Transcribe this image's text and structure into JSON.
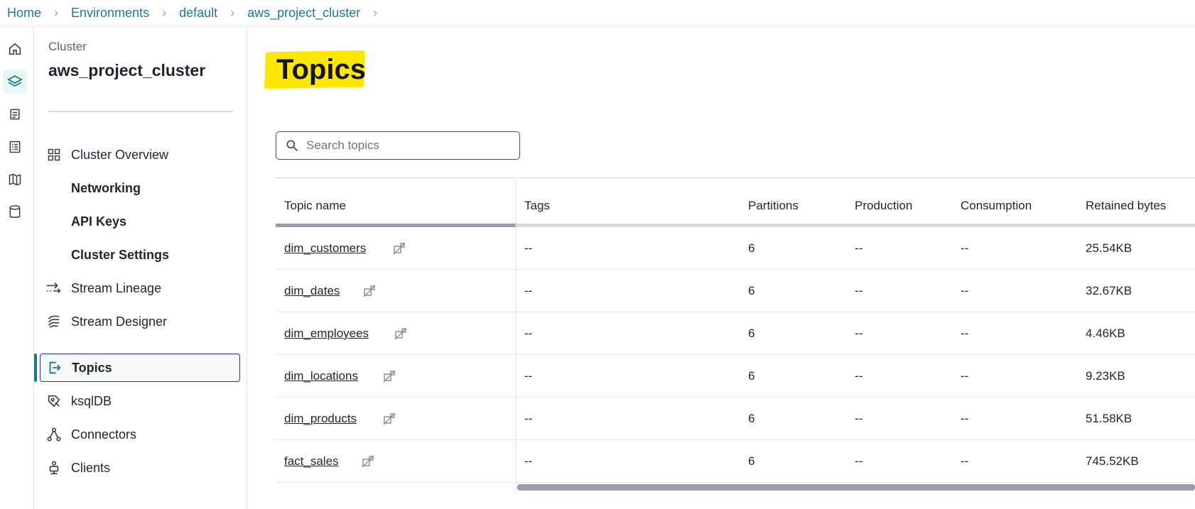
{
  "breadcrumb": {
    "items": [
      "Home",
      "Environments",
      "default",
      "aws_project_cluster"
    ]
  },
  "rail": {
    "icons": [
      "home-icon",
      "layers-icon",
      "document-icon",
      "checklist-icon",
      "map-icon",
      "database-icon"
    ]
  },
  "sidebar": {
    "caption": "Cluster",
    "title": "aws_project_cluster",
    "items": [
      {
        "label": "Cluster Overview",
        "icon": "grid-icon"
      },
      {
        "label": "Networking",
        "icon": ""
      },
      {
        "label": "API Keys",
        "icon": ""
      },
      {
        "label": "Cluster Settings",
        "icon": ""
      },
      {
        "label": "Stream Lineage",
        "icon": "lineage-icon"
      },
      {
        "label": "Stream Designer",
        "icon": "designer-icon"
      },
      {
        "label": "Topics",
        "icon": "topics-icon"
      },
      {
        "label": "ksqlDB",
        "icon": "ksqldb-icon"
      },
      {
        "label": "Connectors",
        "icon": "connectors-icon"
      },
      {
        "label": "Clients",
        "icon": "clients-icon"
      }
    ],
    "active": "Topics"
  },
  "main": {
    "title": "Topics",
    "search": {
      "placeholder": "Search topics",
      "value": ""
    }
  },
  "table": {
    "columns": [
      "Topic name",
      "Tags",
      "Partitions",
      "Production",
      "Consumption",
      "Retained bytes"
    ],
    "rows": [
      {
        "name": "dim_customers",
        "tags": "--",
        "partitions": "6",
        "production": "--",
        "consumption": "--",
        "retained": "25.54KB"
      },
      {
        "name": "dim_dates",
        "tags": "--",
        "partitions": "6",
        "production": "--",
        "consumption": "--",
        "retained": "32.67KB"
      },
      {
        "name": "dim_employees",
        "tags": "--",
        "partitions": "6",
        "production": "--",
        "consumption": "--",
        "retained": "4.46KB"
      },
      {
        "name": "dim_locations",
        "tags": "--",
        "partitions": "6",
        "production": "--",
        "consumption": "--",
        "retained": "9.23KB"
      },
      {
        "name": "dim_products",
        "tags": "--",
        "partitions": "6",
        "production": "--",
        "consumption": "--",
        "retained": "51.58KB"
      },
      {
        "name": "fact_sales",
        "tags": "--",
        "partitions": "6",
        "production": "--",
        "consumption": "--",
        "retained": "745.52KB"
      }
    ]
  },
  "colors": {
    "link": "#1d7a8c",
    "accent": "#187a84",
    "active_border": "#2233aa",
    "highlight": "#ffe800"
  }
}
